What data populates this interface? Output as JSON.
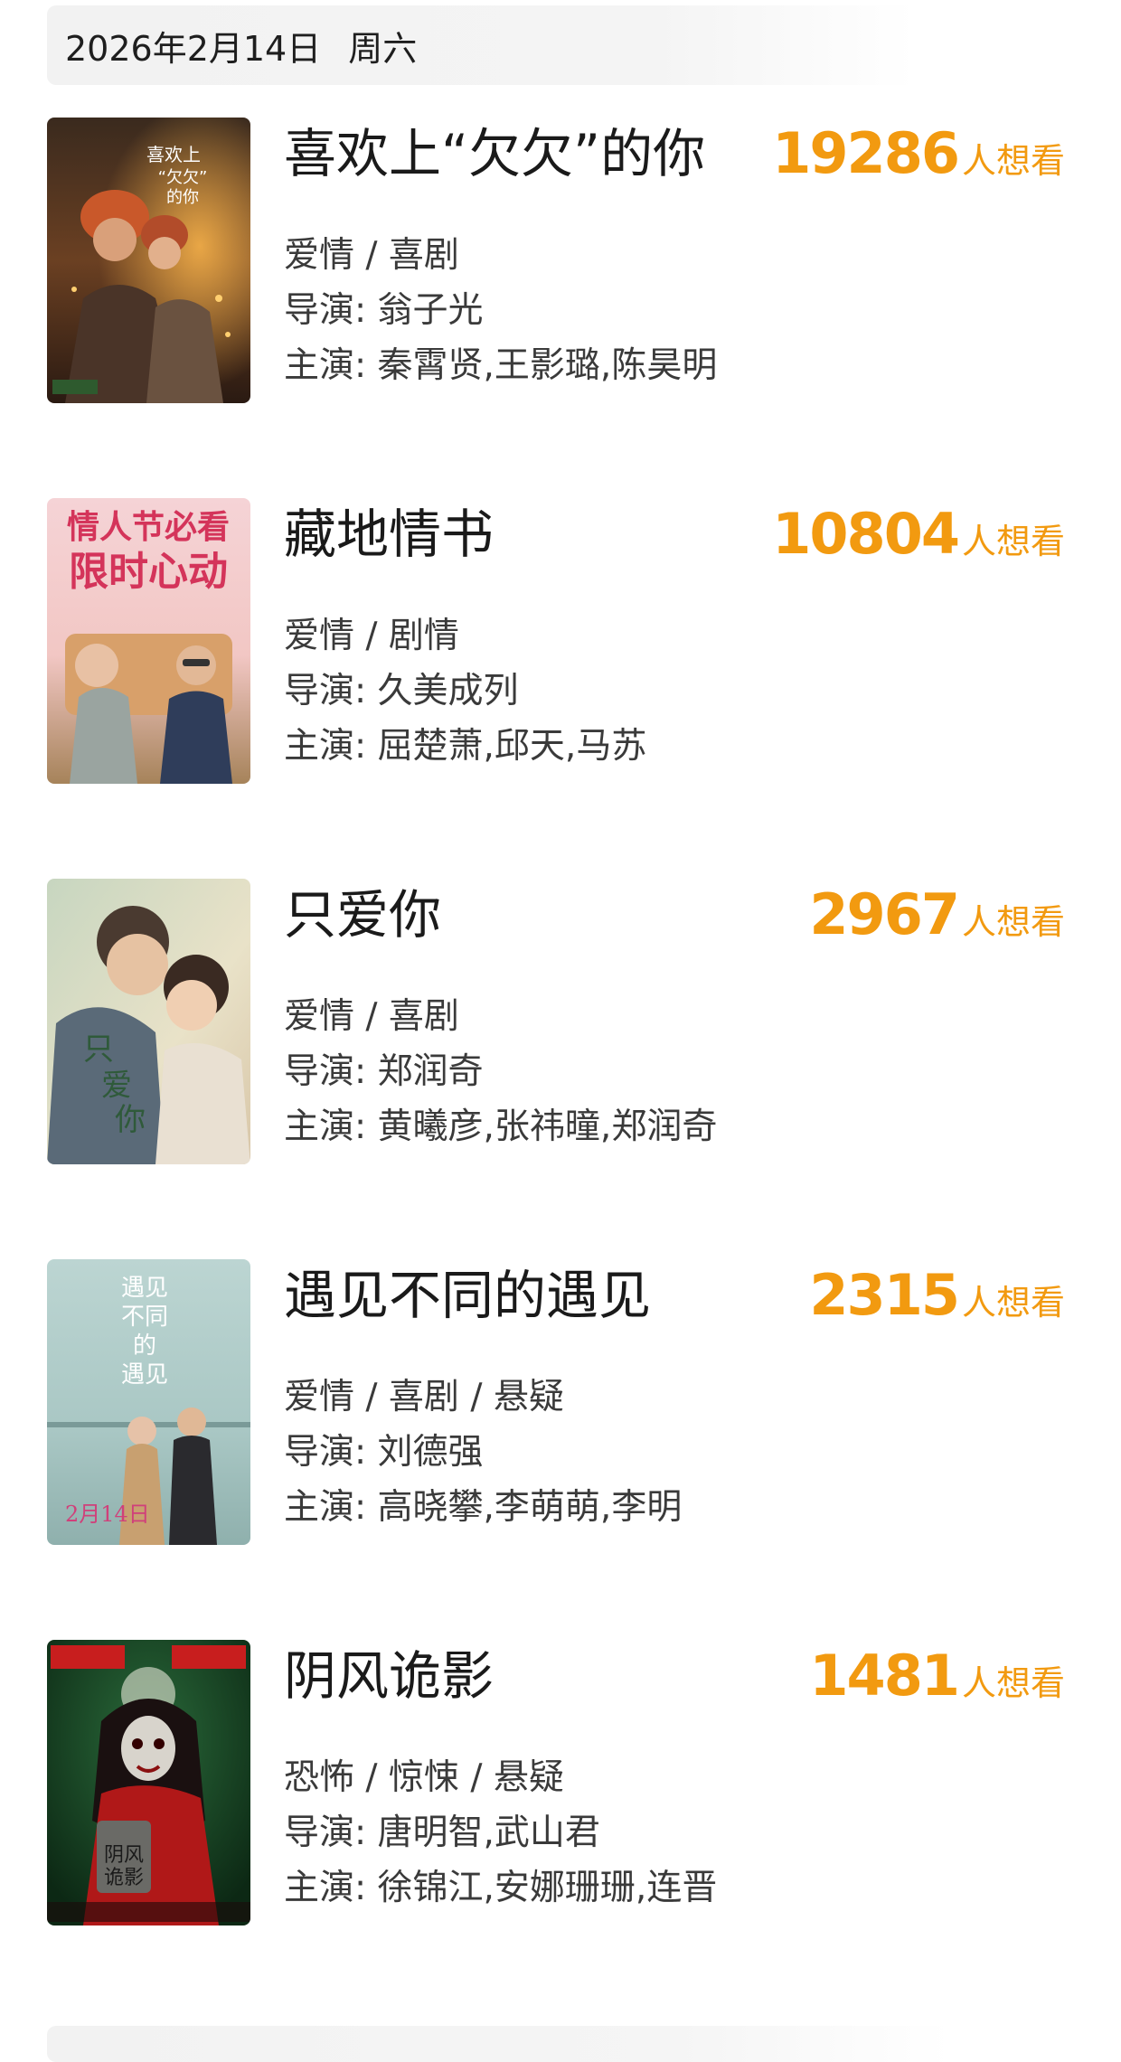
{
  "header": {
    "date": "2026年2月14日",
    "weekday": "周六"
  },
  "want_suffix": "人想看",
  "accent_color": "#f29a10",
  "movies": [
    {
      "title": "喜欢上“欠欠”的你",
      "want_count": "19286",
      "genres": "爱情 / 喜剧",
      "director": "导演: 翁子光",
      "cast": "主演: 秦霄贤,王影璐,陈昊明",
      "poster_text": "喜欢上“欠欠”的你"
    },
    {
      "title": "藏地情书",
      "want_count": "10804",
      "genres": "爱情 / 剧情",
      "director": "导演: 久美成列",
      "cast": "主演: 屈楚萧,邱天,马苏",
      "poster_text": "情人节必看 限时心动"
    },
    {
      "title": "只爱你",
      "want_count": "2967",
      "genres": "爱情 / 喜剧",
      "director": "导演: 郑润奇",
      "cast": "主演: 黄曦彦,张祎曈,郑润奇",
      "poster_text": "只爱你"
    },
    {
      "title": "遇见不同的遇见",
      "want_count": "2315",
      "genres": "爱情 / 喜剧 / 悬疑",
      "director": "导演: 刘德强",
      "cast": "主演: 高晓攀,李萌萌,李明",
      "poster_text": "遇见不同的遇见"
    },
    {
      "title": "阴风诡影",
      "want_count": "1481",
      "genres": "恐怖 / 惊悚 / 悬疑",
      "director": "导演: 唐明智,武山君",
      "cast": "主演: 徐锦江,安娜珊珊,连晋",
      "poster_text": "阴风诡影"
    }
  ]
}
